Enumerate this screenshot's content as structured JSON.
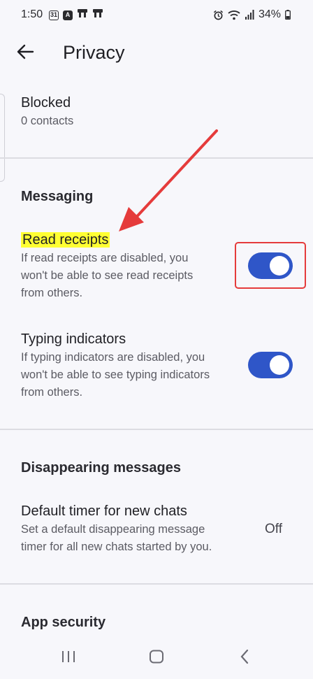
{
  "status_bar": {
    "time": "1:50",
    "icon_calendar": "31",
    "icon_a": "A",
    "battery": "34%"
  },
  "app_bar": {
    "title": "Privacy"
  },
  "blocked": {
    "title": "Blocked",
    "subtitle": "0 contacts"
  },
  "messaging": {
    "header": "Messaging",
    "read_receipts": {
      "title": "Read receipts",
      "line1": "If read receipts are disabled, you",
      "line2": "won't be able to see read receipts",
      "line3": "from others.",
      "enabled": true
    },
    "typing_indicators": {
      "title": "Typing indicators",
      "line1": "If typing indicators are disabled, you",
      "line2": "won't be able to see typing indicators",
      "line3": "from others.",
      "enabled": true
    }
  },
  "disappearing": {
    "header": "Disappearing messages",
    "default_timer": {
      "title": "Default timer for new chats",
      "line1": "Set a default disappearing message",
      "line2": "timer for all new chats started by you.",
      "value": "Off"
    }
  },
  "app_security": {
    "header": "App security"
  },
  "icons": {
    "back": "arrow-left-icon",
    "alarm": "alarm-icon",
    "wifi": "wifi-icon",
    "signal": "signal-icon",
    "battery": "battery-icon",
    "recents": "recents-icon",
    "home": "home-icon",
    "nav_back": "chevron-left-icon"
  },
  "colors": {
    "toggle_on": "#2f56c8",
    "highlight": "#ffff33",
    "annotation": "#e53b3b",
    "background": "#f7f7fb"
  }
}
